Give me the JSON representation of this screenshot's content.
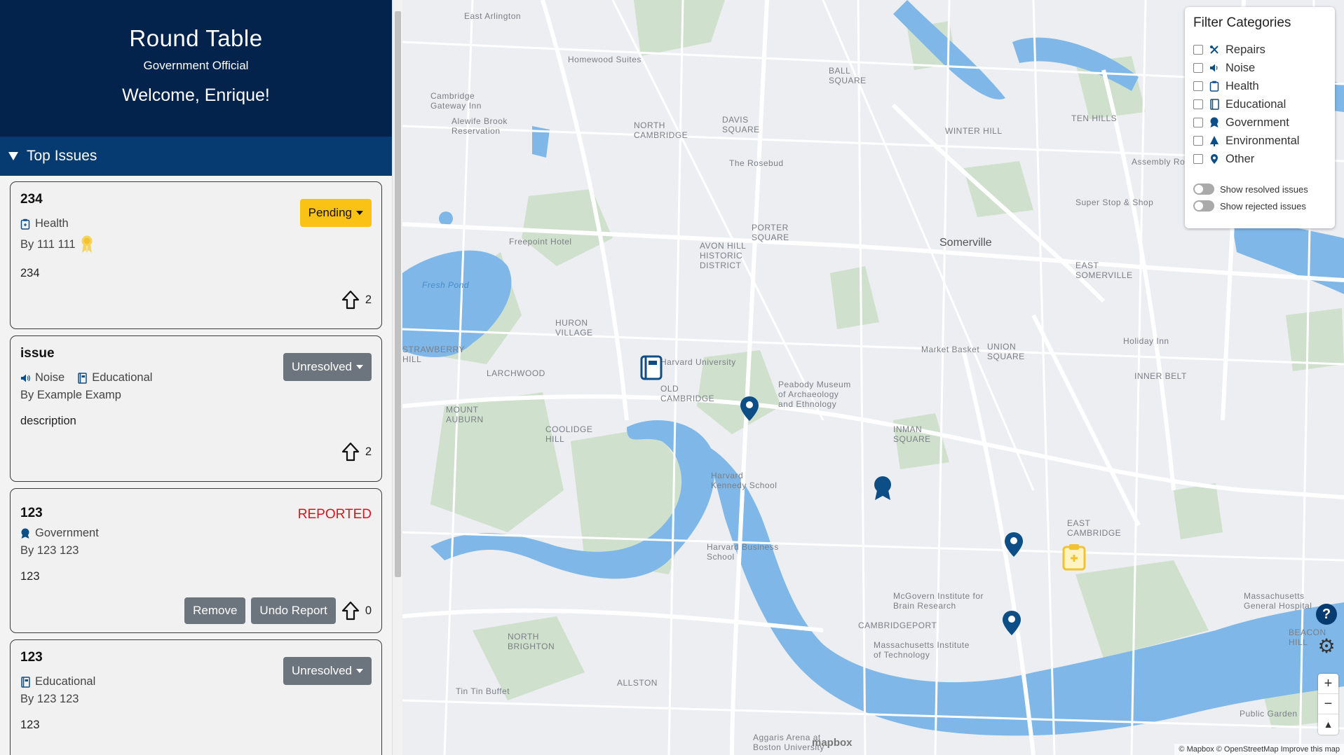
{
  "header": {
    "title": "Round Table",
    "role": "Government Official",
    "welcome": "Welcome, Enrique!"
  },
  "section": {
    "title": "Top Issues"
  },
  "issues": [
    {
      "title": "234",
      "status": "Pending",
      "categories": [
        "Health"
      ],
      "author": "By 111 111",
      "description": "234",
      "votes": "2"
    },
    {
      "title": "issue",
      "status": "Unresolved",
      "categories": [
        "Noise",
        "Educational"
      ],
      "author": "By Example Examp",
      "description": "description",
      "votes": "2"
    },
    {
      "title": "123",
      "status": "REPORTED",
      "categories": [
        "Government"
      ],
      "author": "By 123 123",
      "description": "123",
      "votes": "0",
      "remove_label": "Remove",
      "undo_label": "Undo Report"
    },
    {
      "title": "123",
      "status": "Unresolved",
      "categories": [
        "Educational"
      ],
      "author": "By 123 123",
      "description": "123"
    }
  ],
  "filter": {
    "title": "Filter Categories",
    "categories": [
      "Repairs",
      "Noise",
      "Health",
      "Educational",
      "Government",
      "Environmental",
      "Other"
    ],
    "toggles": [
      "Show resolved issues",
      "Show rejected issues"
    ]
  },
  "map": {
    "labels": [
      "East Arlington",
      "Homewood Suites",
      "Cambridge Gateway Inn",
      "Alewife Brook Reservation",
      "NORTH CAMBRIDGE",
      "DAVIS SQUARE",
      "BALL SQUARE",
      "TEN HILLS",
      "WINTER HILL",
      "Assembly Row",
      "The Rosebud",
      "Super Stop & Shop",
      "Freepoint Hotel",
      "PORTER SQUARE",
      "AVON HILL HISTORIC DISTRICT",
      "Somerville",
      "EAST SOMERVILLE",
      "HURON VILLAGE",
      "Harvard University",
      "Peabody Museum of Archaeology and Ethnology",
      "Market Basket",
      "UNION SQUARE",
      "Holiday Inn",
      "INNER BELT",
      "LARCHWOOD",
      "OLD CAMBRIDGE",
      "MOUNT AUBURN",
      "COOLIDGE HILL",
      "Harvard Kennedy School",
      "INMAN SQUARE",
      "EAST CAMBRIDGE",
      "Harvard Business School",
      "McGovern Institute for Brain Research",
      "Massachusetts General Hospital",
      "CAMBRIDGEPORT",
      "Massachusetts Institute of Technology",
      "NORTH BRIGHTON",
      "ALLSTON",
      "Tin Tin Buffet",
      "Aggaris Arena at Boston University",
      "BEACON HILL",
      "Public Garden",
      "Fresh Pond",
      "STRAWBERRY HILL"
    ],
    "attribution": "© Mapbox © OpenStreetMap  Improve this map",
    "logo": "mapbox",
    "help": "?"
  },
  "colors": {
    "navy": "#03234d",
    "bar": "#063b72",
    "pending": "#fac214",
    "reported": "#e0121e",
    "water": "#7fb8e8",
    "park": "#cfe0cc"
  }
}
